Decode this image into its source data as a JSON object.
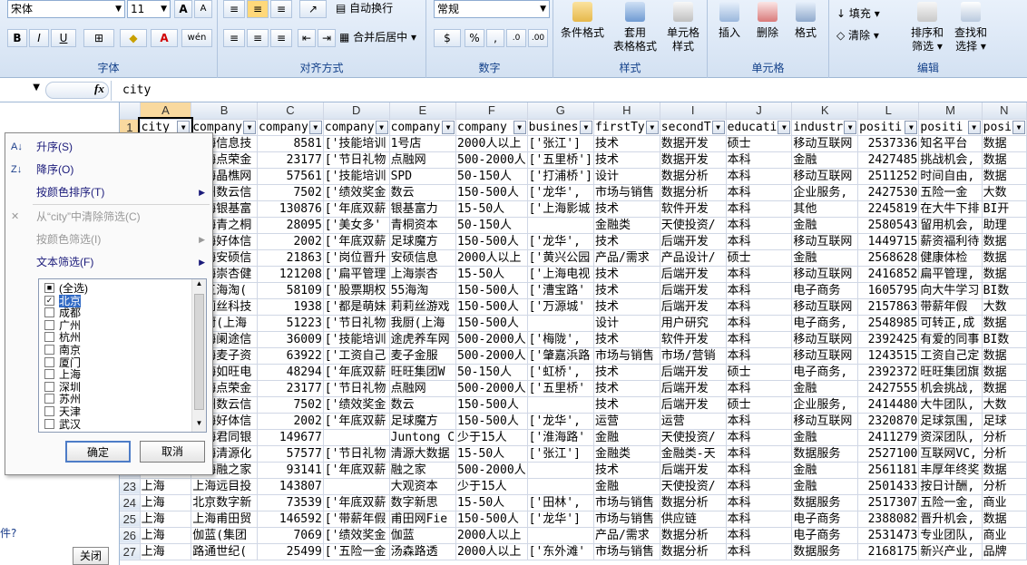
{
  "ribbon": {
    "font_name": "宋体",
    "font_size": "11",
    "wrap_text": "自动换行",
    "merge_center": "合并后居中",
    "number_format": "常规",
    "cond_format": "条件格式",
    "apply_format_1": "套用",
    "apply_format_2": "表格格式",
    "cell_style_1": "单元格",
    "cell_style_2": "样式",
    "insert": "插入",
    "delete": "删除",
    "format": "格式",
    "fill": "填充",
    "clear": "清除",
    "sort_filter_1": "排序和",
    "sort_filter_2": "筛选",
    "find_select_1": "查找和",
    "find_select_2": "选择",
    "groups": {
      "font": "字体",
      "align": "对齐方式",
      "number": "数字",
      "style": "样式",
      "cells": "单元格",
      "edit": "编辑"
    }
  },
  "formula": {
    "fx": "fx",
    "value": "city"
  },
  "columns": [
    "A",
    "B",
    "C",
    "D",
    "E",
    "F",
    "G",
    "H",
    "I",
    "J",
    "K",
    "L",
    "M",
    "N"
  ],
  "rows": [
    {
      "n": "1",
      "c": [
        "city",
        "company",
        "company",
        "company",
        "company",
        "company",
        "busines",
        "firstTy",
        "secondT",
        "educati",
        "industr",
        "positi",
        "positi",
        "posi"
      ]
    },
    {
      "n": "2",
      "c": [
        "",
        "纽海信息技",
        "8581",
        "['技能培训",
        "1号店",
        "2000人以上",
        "['张江']",
        "技术",
        "数据开发",
        "硕士",
        "移动互联网",
        "2537336",
        "知名平台",
        "数据"
      ]
    },
    {
      "n": "3",
      "c": [
        "",
        "上海点荣金",
        "23177",
        "['节日礼物",
        "点融网",
        "500-2000人",
        "['五里桥']",
        "技术",
        "数据开发",
        "本科",
        "金融",
        "2427485",
        "挑战机会,",
        "数据"
      ]
    },
    {
      "n": "4",
      "c": [
        "",
        "上海晶樵网",
        "57561",
        "['技能培训",
        "SPD",
        "50-150人",
        "['打浦桥']",
        "设计",
        "数据分析",
        "本科",
        "移动互联网",
        "2511252",
        "时间自由,",
        "数据"
      ]
    },
    {
      "n": "5",
      "c": [
        "",
        "杭州数云信",
        "7502",
        "['绩效奖金",
        "数云",
        "150-500人",
        "['龙华',",
        "市场与销售",
        "数据分析",
        "本科",
        "企业服务,",
        "2427530",
        "五险一金",
        "大数"
      ]
    },
    {
      "n": "6",
      "c": [
        "",
        "上海银基富",
        "130876",
        "['年底双薪",
        "银基富力",
        "15-50人",
        "['上海影城",
        "技术",
        "软件开发",
        "本科",
        "其他",
        "2245819",
        "在大牛下排",
        "BI开"
      ]
    },
    {
      "n": "7",
      "c": [
        "",
        "上海青之桐",
        "28095",
        "['美女多'",
        "青桐资本",
        "50-150人",
        "",
        "金融类",
        "天使投资/",
        "本科",
        "金融",
        "2580543",
        "留用机会,",
        "助理"
      ]
    },
    {
      "n": "8",
      "c": [
        "",
        "上海好体信",
        "2002",
        "['年底双薪",
        "足球魔方",
        "150-500人",
        "['龙华',",
        "技术",
        "后端开发",
        "本科",
        "移动互联网",
        "1449715",
        "薪资福利待",
        "数据"
      ]
    },
    {
      "n": "9",
      "c": [
        "",
        "上海安硕信",
        "21863",
        "['岗位晋升",
        "安硕信息",
        "2000人以上",
        "['黄兴公园",
        "产品/需求",
        "产品设计/",
        "硕士",
        "金融",
        "2568628",
        "健康体检",
        "数据"
      ]
    },
    {
      "n": "10",
      "c": [
        "",
        "上海崇杏健",
        "121208",
        "['扁平管理",
        "上海崇杏",
        "15-50人",
        "['上海电视",
        "技术",
        "后端开发",
        "本科",
        "移动互联网",
        "2416852",
        "扁平管理,",
        "数据"
      ]
    },
    {
      "n": "11",
      "c": [
        "",
        "五五海淘(",
        "58109",
        "['股票期权",
        "55海淘",
        "150-500人",
        "['漕宝路'",
        "技术",
        "后端开发",
        "本科",
        "电子商务",
        "1605795",
        "向大牛学习",
        "BI数"
      ]
    },
    {
      "n": "12",
      "c": [
        "",
        "莉莉丝科技",
        "1938",
        "['都是萌妹",
        "莉莉丝游戏",
        "150-500人",
        "['万源城'",
        "技术",
        "后端开发",
        "本科",
        "移动互联网",
        "2157863",
        "带薪年假",
        "大数"
      ]
    },
    {
      "n": "13",
      "c": [
        "",
        "我厨(上海",
        "51223",
        "['节日礼物",
        "我厨(上海",
        "150-500人",
        "",
        "设计",
        "用户研究",
        "本科",
        "电子商务,",
        "2548985",
        "可转正,成",
        "数据"
      ]
    },
    {
      "n": "14",
      "c": [
        "",
        "上海阑途信",
        "36009",
        "['技能培训",
        "途虎养车网",
        "500-2000人",
        "['梅陇',",
        "技术",
        "软件开发",
        "本科",
        "移动互联网",
        "2392425",
        "有爱的同事",
        "BI数"
      ]
    },
    {
      "n": "15",
      "c": [
        "",
        "上海麦子资",
        "63922",
        "['工资自己",
        "麦子金服",
        "500-2000人",
        "['肇嘉浜路",
        "市场与销售",
        "市场/营销",
        "本科",
        "移动互联网",
        "1243515",
        "工资自己定",
        "数据"
      ]
    },
    {
      "n": "16",
      "c": [
        "",
        "上海如旺电",
        "48294",
        "['年底双薪",
        "旺旺集团W",
        "50-150人",
        "['虹桥',",
        "技术",
        "后端开发",
        "硕士",
        "电子商务,",
        "2392372",
        "旺旺集团旗",
        "数据"
      ]
    },
    {
      "n": "17",
      "c": [
        "",
        "上海点荣金",
        "23177",
        "['节日礼物",
        "点融网",
        "500-2000人",
        "['五里桥'",
        "技术",
        "后端开发",
        "本科",
        "金融",
        "2427555",
        "机会挑战,",
        "数据"
      ]
    },
    {
      "n": "18",
      "c": [
        "",
        "杭州数云信",
        "7502",
        "['绩效奖金",
        "数云",
        "150-500人",
        "",
        "技术",
        "后端开发",
        "硕士",
        "企业服务,",
        "2414480",
        "大牛团队,",
        "大数"
      ]
    },
    {
      "n": "19",
      "c": [
        "",
        "上海好体信",
        "2002",
        "['年底双薪",
        "足球魔方",
        "150-500人",
        "['龙华',",
        "运营",
        "运营",
        "本科",
        "移动互联网",
        "2320870",
        "足球氛围,",
        "足球"
      ]
    },
    {
      "n": "20",
      "c": [
        "",
        "上海君同银",
        "149677",
        "",
        "Juntong C",
        "少于15人",
        "['淮海路'",
        "金融",
        "天使投资/",
        "本科",
        "金融",
        "2411279",
        "资深团队,",
        "分析"
      ]
    },
    {
      "n": "21",
      "c": [
        "",
        "上海清源化",
        "57577",
        "['节日礼物",
        "清源大数据",
        "15-50人",
        "['张江']",
        "金融类",
        "金融类-天",
        "本科",
        "数据服务",
        "2527100",
        "互联网VC,",
        "分析"
      ]
    },
    {
      "n": "22",
      "c": [
        "",
        "上海融之家",
        "93141",
        "['年底双薪",
        "融之家",
        "500-2000人",
        "",
        "技术",
        "后端开发",
        "本科",
        "金融",
        "2561181",
        "丰厚年终奖",
        "数据"
      ]
    },
    {
      "n": "23",
      "c": [
        "上海",
        "上海远目投",
        "143807",
        "",
        "大观资本",
        "少于15人",
        "",
        "金融",
        "天使投资/",
        "本科",
        "金融",
        "2501433",
        "按日计酬,",
        "分析"
      ]
    },
    {
      "n": "24",
      "c": [
        "上海",
        "北京数字新",
        "73539",
        "['年底双薪",
        "数字新思",
        "15-50人",
        "['田林',",
        "市场与销售",
        "数据分析",
        "本科",
        "数据服务",
        "2517307",
        "五险一金,",
        "商业"
      ]
    },
    {
      "n": "25",
      "c": [
        "上海",
        "上海甫田贸",
        "146592",
        "['带薪年假",
        "甫田网Fie",
        "150-500人",
        "['龙华']",
        "市场与销售",
        "供应链",
        "本科",
        "电子商务",
        "2388082",
        "晋升机会,",
        "数据"
      ]
    },
    {
      "n": "26",
      "c": [
        "上海",
        "伽蓝(集团",
        "7069",
        "['绩效奖金",
        "伽蓝",
        "2000人以上",
        "",
        "产品/需求",
        "数据分析",
        "本科",
        "电子商务",
        "2531473",
        "专业团队,",
        "商业"
      ]
    },
    {
      "n": "27",
      "c": [
        "上海",
        "路通世纪(",
        "25499",
        "['五险一金",
        "汤森路透",
        "2000人以上",
        "['东外滩'",
        "市场与销售",
        "数据分析",
        "本科",
        "数据服务",
        "2168175",
        "新兴产业,",
        "品牌"
      ]
    }
  ],
  "filter_menu": {
    "sort_asc": "升序(S)",
    "sort_desc": "降序(O)",
    "sort_color": "按颜色排序(T)",
    "clear_filter": "从“city”中清除筛选(C)",
    "filter_color": "按颜色筛选(I)",
    "text_filter": "文本筛选(F)",
    "list": [
      "(全选)",
      "北京",
      "成都",
      "广州",
      "杭州",
      "南京",
      "厦门",
      "上海",
      "深圳",
      "苏州",
      "天津",
      "武汉"
    ],
    "ok": "确定",
    "cancel": "取消"
  },
  "left_pane": {
    "question": "件?",
    "close": "关闭"
  }
}
